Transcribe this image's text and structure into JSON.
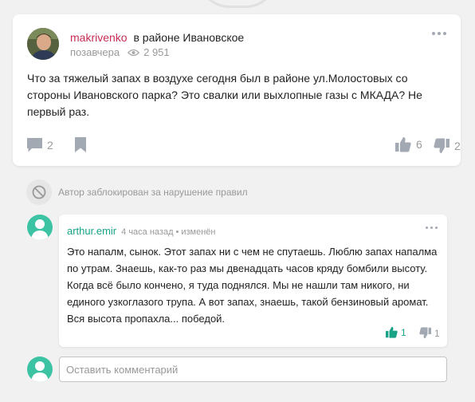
{
  "post": {
    "author": "makrivenko",
    "location": "в районе Ивановское",
    "time": "позавчера",
    "views": "2 951",
    "text": "Что за тяжелый запах в воздухе сегодня был в районе ул.Молостовых со стороны Ивановского парка? Это свалки или выхлопные газы с МКАДА? Не первый раз.",
    "comments_count": "2",
    "likes": "6",
    "dislikes": "2"
  },
  "blocked_notice": "Автор заблокирован за нарушение правил",
  "comment": {
    "author": "arthur.emir",
    "time": "4 часа назад",
    "separator": "•",
    "edited": "изменён",
    "text": "Это напалм, сынок. Этот запах ни с чем не спутаешь. Люблю запах напалма по утрам. Знаешь, как-то раз мы двенадцать часов кряду бомбили высоту. Когда всё было кончено, я туда поднялся. Мы не нашли там никого, ни единого узкоглазого трупа. А вот запах, знаешь, такой бензиновый аромат. Вся высота пропахла... победой.",
    "likes": "1",
    "dislikes": "1"
  },
  "reply_input": {
    "placeholder": "Оставить комментарий"
  },
  "colors": {
    "author_accent": "#c72d54",
    "comment_author": "#18a387",
    "avatar_green": "#3cc3a4",
    "muted": "#999999"
  },
  "icons": [
    "comment-icon",
    "bookmark-icon",
    "thumbs-up-icon",
    "thumbs-down-icon",
    "eye-icon",
    "blocked-icon",
    "more-icon",
    "user-icon"
  ]
}
